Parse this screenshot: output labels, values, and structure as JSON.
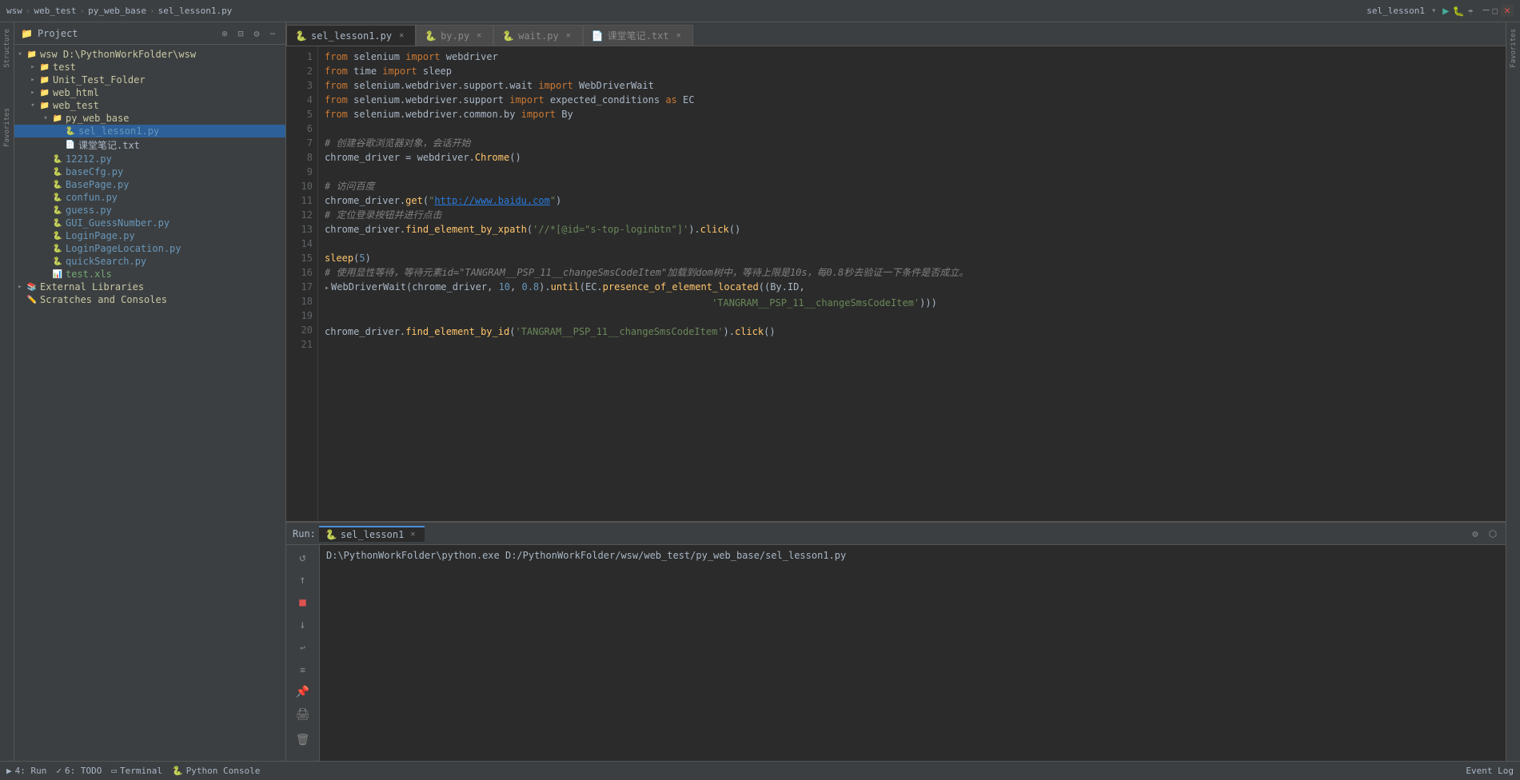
{
  "titlebar": {
    "tabs": [
      {
        "label": "wsw",
        "active": false
      },
      {
        "label": "web_test",
        "active": false
      },
      {
        "label": "py_web_base",
        "active": false
      },
      {
        "label": "sel_lesson1.py",
        "active": true
      }
    ],
    "run_config": "sel_lesson1"
  },
  "project": {
    "title": "Project",
    "tree": [
      {
        "id": "wsw-root",
        "indent": 0,
        "arrow": "▾",
        "icon": "📁",
        "label": "wsw  D:\\PythonWorkFolder\\wsw",
        "type": "folder",
        "expanded": true
      },
      {
        "id": "test",
        "indent": 1,
        "arrow": "▸",
        "icon": "📁",
        "label": "test",
        "type": "folder"
      },
      {
        "id": "unit-test",
        "indent": 1,
        "arrow": "▸",
        "icon": "📁",
        "label": "Unit_Test_Folder",
        "type": "folder"
      },
      {
        "id": "web-html",
        "indent": 1,
        "arrow": "▸",
        "icon": "📁",
        "label": "web_html",
        "type": "folder"
      },
      {
        "id": "web-test",
        "indent": 1,
        "arrow": "▾",
        "icon": "📁",
        "label": "web_test",
        "type": "folder",
        "expanded": true
      },
      {
        "id": "py-web-base",
        "indent": 2,
        "arrow": "▾",
        "icon": "📁",
        "label": "py_web_base",
        "type": "folder",
        "expanded": true
      },
      {
        "id": "sel-lesson1",
        "indent": 3,
        "arrow": "",
        "icon": "🐍",
        "label": "sel_lesson1.py",
        "type": "py",
        "selected": true
      },
      {
        "id": "notes",
        "indent": 3,
        "arrow": "",
        "icon": "📄",
        "label": "课堂笔记.txt",
        "type": "txt"
      },
      {
        "id": "file-12212",
        "indent": 2,
        "arrow": "",
        "icon": "🐍",
        "label": "12212.py",
        "type": "py"
      },
      {
        "id": "basecfg",
        "indent": 2,
        "arrow": "",
        "icon": "🐍",
        "label": "baseCfg.py",
        "type": "py"
      },
      {
        "id": "basepage",
        "indent": 2,
        "arrow": "",
        "icon": "🐍",
        "label": "BasePage.py",
        "type": "py"
      },
      {
        "id": "confun",
        "indent": 2,
        "arrow": "",
        "icon": "🐍",
        "label": "confun.py",
        "type": "py"
      },
      {
        "id": "guess",
        "indent": 2,
        "arrow": "",
        "icon": "🐍",
        "label": "guess.py",
        "type": "py"
      },
      {
        "id": "gui-guess",
        "indent": 2,
        "arrow": "",
        "icon": "🐍",
        "label": "GUI_GuessNumber.py",
        "type": "py"
      },
      {
        "id": "loginpage",
        "indent": 2,
        "arrow": "",
        "icon": "🐍",
        "label": "LoginPage.py",
        "type": "py"
      },
      {
        "id": "loginloc",
        "indent": 2,
        "arrow": "",
        "icon": "🐍",
        "label": "LoginPageLocation.py",
        "type": "py"
      },
      {
        "id": "quicksearch",
        "indent": 2,
        "arrow": "",
        "icon": "🐍",
        "label": "quickSearch.py",
        "type": "py"
      },
      {
        "id": "testxls",
        "indent": 2,
        "arrow": "",
        "icon": "📊",
        "label": "test.xls",
        "type": "xls"
      },
      {
        "id": "ext-libs",
        "indent": 0,
        "arrow": "▸",
        "icon": "📚",
        "label": "External Libraries",
        "type": "folder"
      },
      {
        "id": "scratches",
        "indent": 0,
        "arrow": "",
        "icon": "✏️",
        "label": "Scratches and Consoles",
        "type": "folder"
      }
    ]
  },
  "editor": {
    "tabs": [
      {
        "label": "sel_lesson1.py",
        "active": true
      },
      {
        "label": "by.py",
        "active": false
      },
      {
        "label": "wait.py",
        "active": false
      },
      {
        "label": "课堂笔记.txt",
        "active": false
      }
    ],
    "lines": [
      {
        "num": 1,
        "content": "from selenium import webdriver"
      },
      {
        "num": 2,
        "content": "from time import sleep"
      },
      {
        "num": 3,
        "content": "from selenium.webdriver.support.wait import WebDriverWait"
      },
      {
        "num": 4,
        "content": "from selenium.webdriver.support import expected_conditions as EC"
      },
      {
        "num": 5,
        "content": "from selenium.webdriver.common.by import By"
      },
      {
        "num": 6,
        "content": ""
      },
      {
        "num": 7,
        "content": "# 创建谷歌浏览器对象，会话开始"
      },
      {
        "num": 8,
        "content": "chrome_driver = webdriver.Chrome()"
      },
      {
        "num": 9,
        "content": ""
      },
      {
        "num": 10,
        "content": "# 访问百度"
      },
      {
        "num": 11,
        "content": "chrome_driver.get(\"http://www.baidu.com\")"
      },
      {
        "num": 12,
        "content": "# 定位登录按钮并进行点击"
      },
      {
        "num": 13,
        "content": "chrome_driver.find_element_by_xpath('//*[@id=\"s-top-loginbtn\"]').click()"
      },
      {
        "num": 14,
        "content": ""
      },
      {
        "num": 15,
        "content": "sleep(5)"
      },
      {
        "num": 16,
        "content": "# 使用显性等待，等待元素id=\"TANGRAM__PSP_11__changeSmsCodeItem\"加载到dom树中，等待上限是10s，每0.8秒去验证一下条件是否成立。"
      },
      {
        "num": 17,
        "content": "WebDriverWait(chrome_driver, 10, 0.8).until(EC.presence_of_element_located((By.ID,"
      },
      {
        "num": 18,
        "content": "                                                                               'TANGRAM__PSP_11__changeSmsCodeItem')))"
      },
      {
        "num": 19,
        "content": ""
      },
      {
        "num": 20,
        "content": "chrome_driver.find_element_by_id('TANGRAM__PSP_11__changeSmsCodeItem').click()"
      },
      {
        "num": 21,
        "content": ""
      }
    ]
  },
  "run_panel": {
    "label": "Run:",
    "tab_label": "sel_lesson1",
    "output": "D:\\PythonWorkFolder\\python.exe D:/PythonWorkFolder/wsw/web_test/py_web_base/sel_lesson1.py"
  },
  "status_bar": {
    "items": [
      {
        "label": "4: Run",
        "icon": "▶"
      },
      {
        "label": "6: TODO"
      },
      {
        "label": "Terminal"
      },
      {
        "label": "Python Console"
      }
    ],
    "right": "Event Log"
  }
}
